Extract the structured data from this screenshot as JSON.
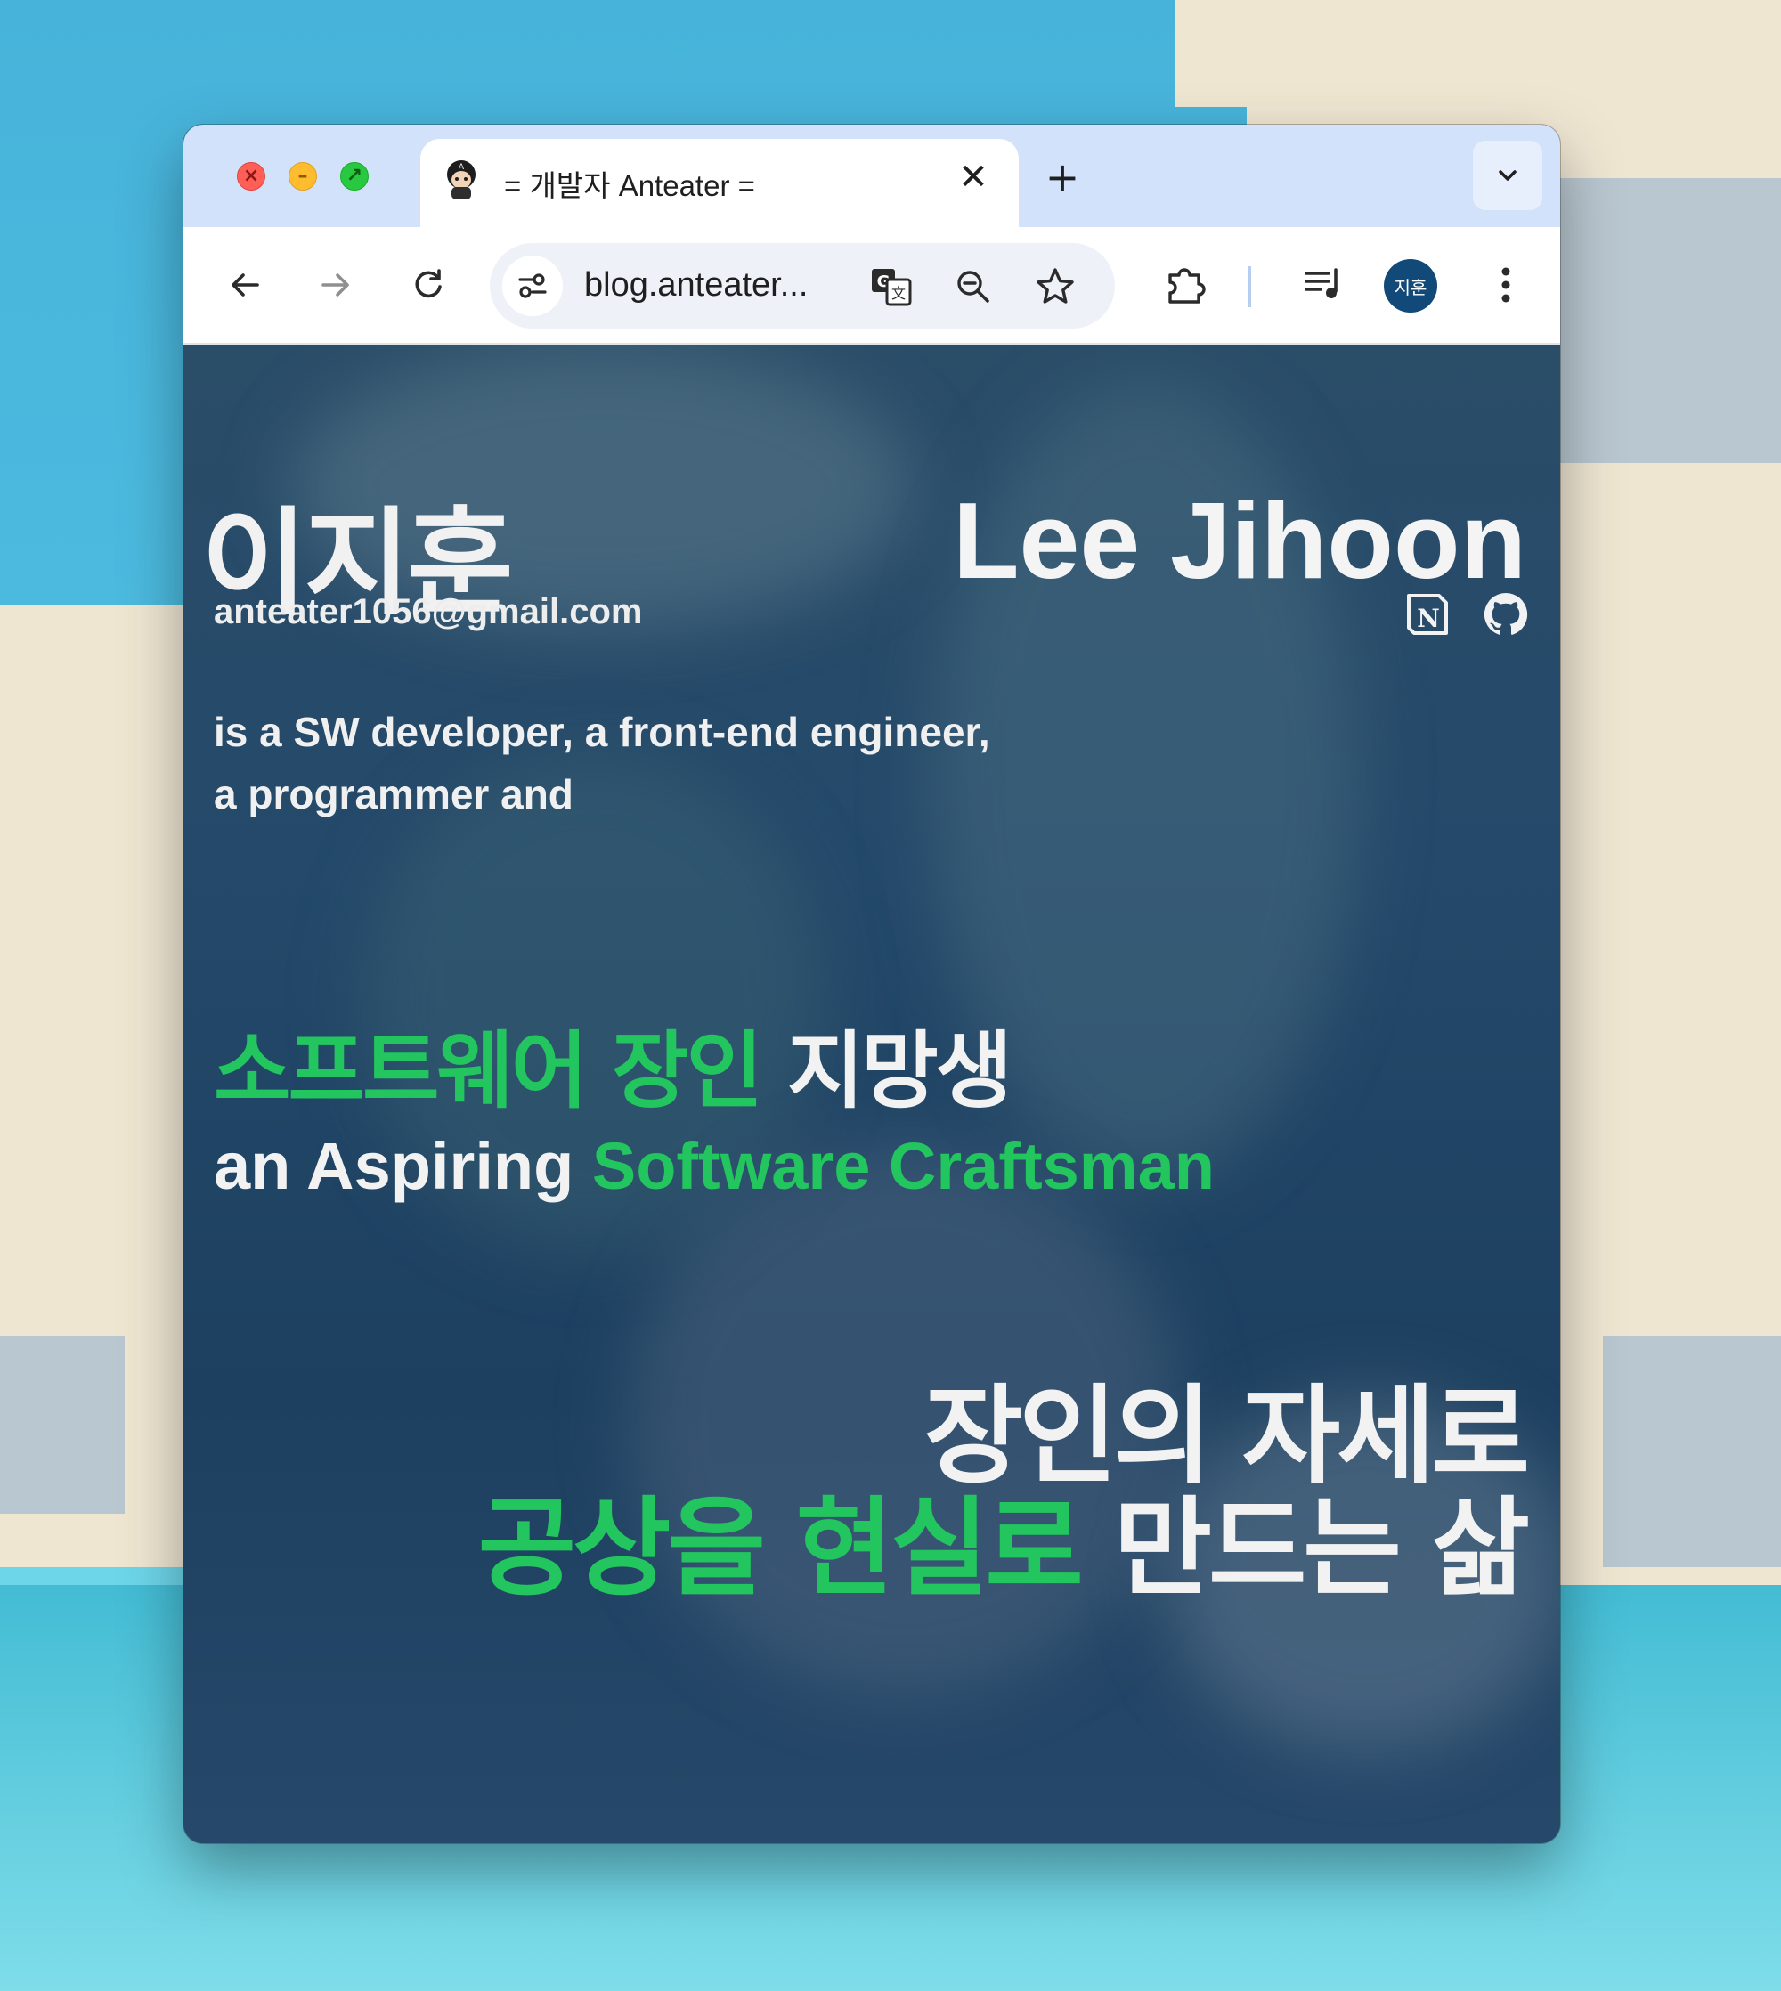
{
  "browser": {
    "tab": {
      "title": "= 개발자 Anteater =",
      "close_label": "✕"
    },
    "new_tab_label": "+",
    "address_bar": {
      "url": "blog.anteater..."
    },
    "profile": {
      "initials": "지훈"
    }
  },
  "page": {
    "name_korean": "이지훈",
    "name_english": "Lee Jihoon",
    "email": "anteater1056@gmail.com",
    "intro_lines": [
      "is a SW developer, a front-end engineer,",
      "a programmer and"
    ],
    "slogan_korean": {
      "highlight": "소프트웨어 장인",
      "rest": " 지망생"
    },
    "slogan_english": {
      "prefix": "an Aspiring ",
      "highlight": "Software Craftsman"
    },
    "motto": {
      "line1": "장인의 자세로",
      "line2_highlight": "공상을 현실로",
      "line2_rest": " 만드는 삶"
    },
    "social_icons": [
      "notion-icon",
      "github-icon"
    ]
  },
  "colors": {
    "accent_green": "#22c55e",
    "tabbar": "#d3e2fb",
    "profile": "#114a78"
  }
}
